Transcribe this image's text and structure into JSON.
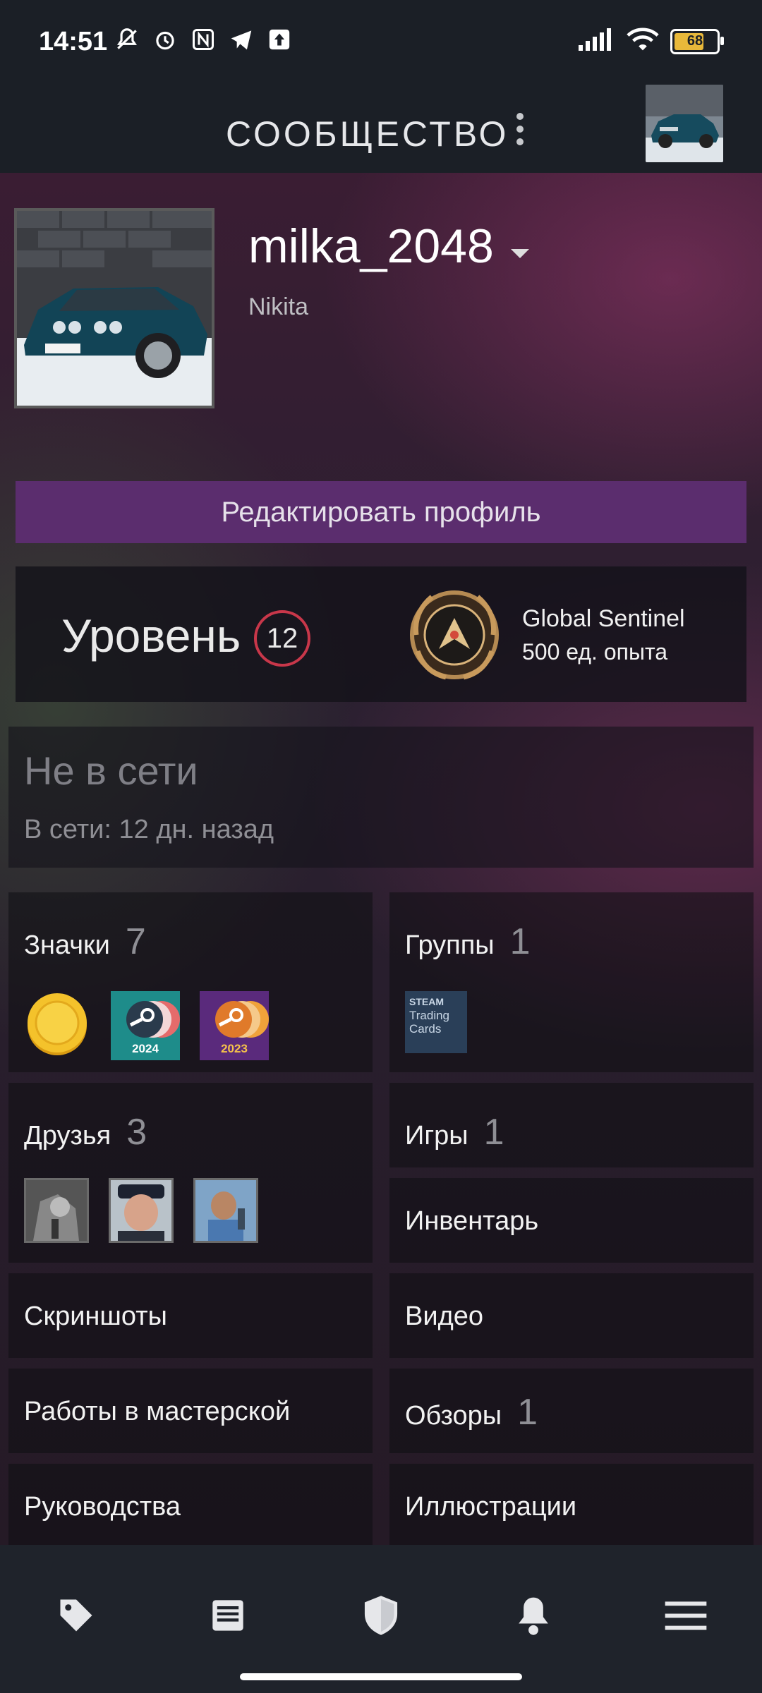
{
  "status_bar": {
    "time": "14:51",
    "battery": "68"
  },
  "header": {
    "title": "СООБЩЕСТВО"
  },
  "profile": {
    "username": "milka_2048",
    "real_name": "Nikita",
    "edit_button": "Редактировать профиль",
    "level_label": "Уровень",
    "level_value": "12",
    "badge_name": "Global Sentinel",
    "badge_xp": "500 ед. опыта",
    "status": "Не в сети",
    "last_online": "В сети: 12 дн. назад"
  },
  "sections": {
    "badges": {
      "label": "Значки",
      "count": "7",
      "items": [
        "2024",
        "2023"
      ]
    },
    "groups": {
      "label": "Группы",
      "count": "1",
      "group_icon_text": [
        "STEAM",
        "Trading",
        "Cards"
      ]
    },
    "friends": {
      "label": "Друзья",
      "count": "3"
    },
    "games": {
      "label": "Игры",
      "count": "1"
    },
    "inventory": {
      "label": "Инвентарь"
    },
    "screenshots": {
      "label": "Скриншоты"
    },
    "video": {
      "label": "Видео"
    },
    "workshop": {
      "label": "Работы в мастерской"
    },
    "reviews": {
      "label": "Обзоры",
      "count": "1"
    },
    "guides": {
      "label": "Руководства"
    },
    "artwork": {
      "label": "Иллюстрации"
    }
  },
  "bottom_nav": [
    "tag-icon",
    "news-icon",
    "shield-icon",
    "bell-icon",
    "menu-icon"
  ],
  "colors": {
    "accent_purple": "#5b2d6e",
    "level_ring": "#c8374a",
    "bg": "#171a21"
  }
}
